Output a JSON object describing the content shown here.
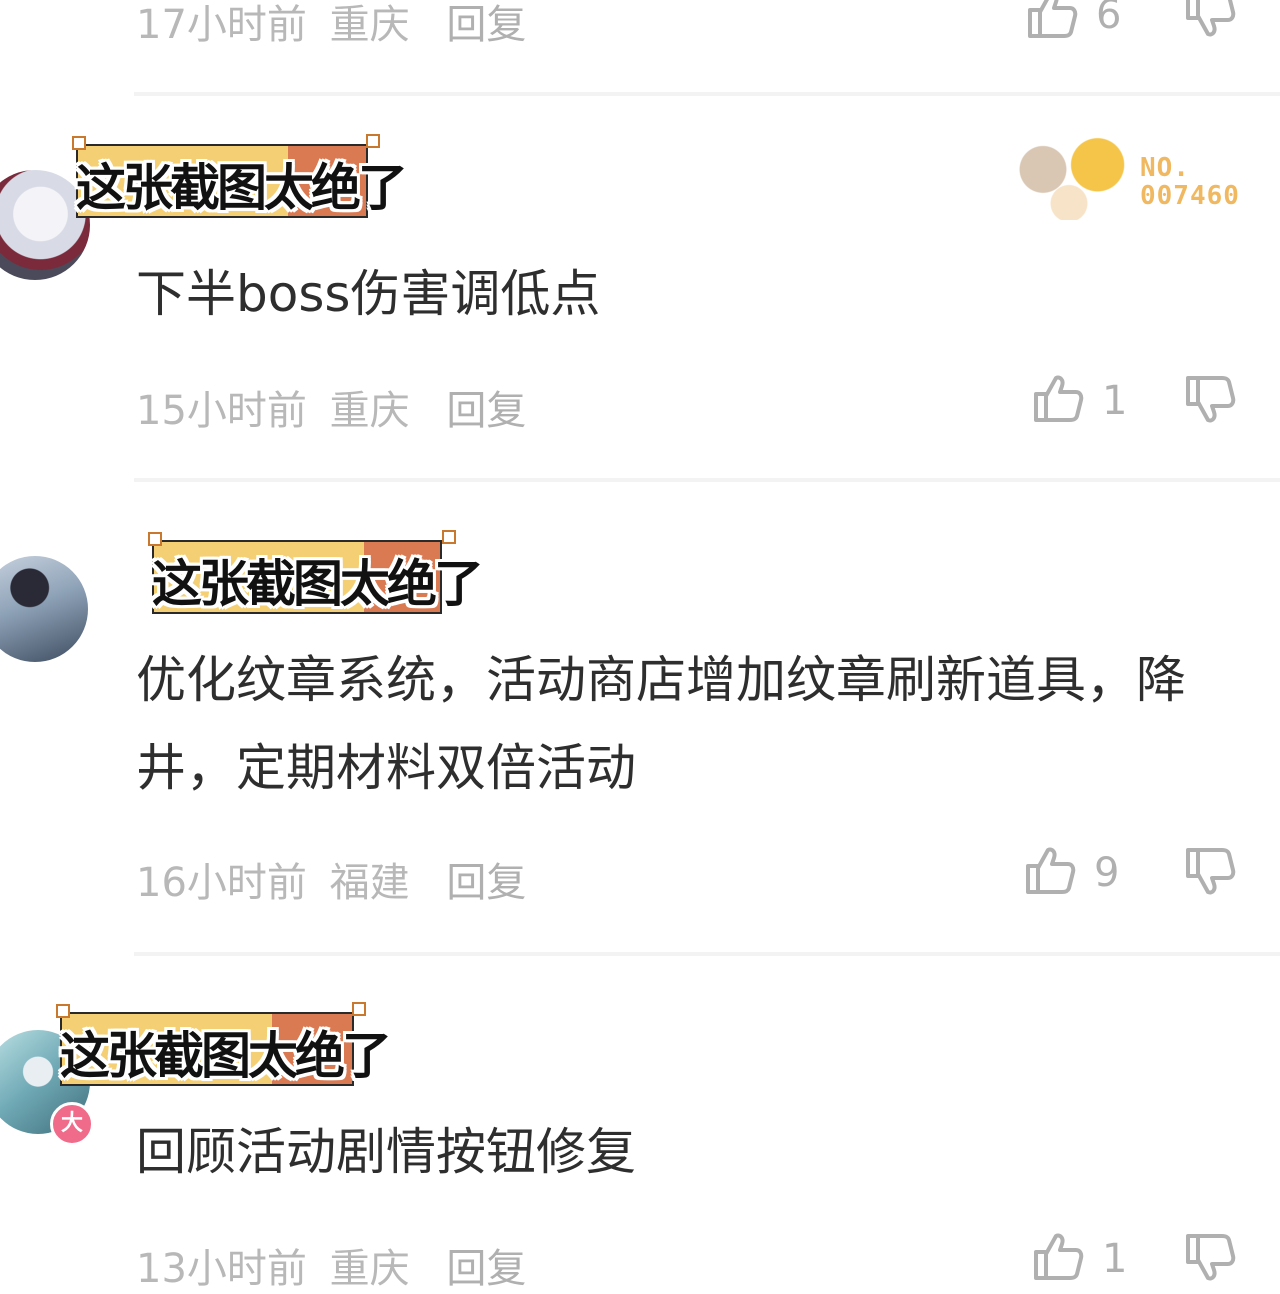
{
  "sticker_text": "这张截图太绝了",
  "comments": [
    {
      "time": "17小时前",
      "location": "重庆",
      "reply": "回复",
      "likes": "6",
      "content": ""
    },
    {
      "time": "15小时前",
      "location": "重庆",
      "reply": "回复",
      "likes": "1",
      "content": "下半boss伤害调低点",
      "badge": {
        "line1": "NO.",
        "line2": "007460"
      }
    },
    {
      "time": "16小时前",
      "location": "福建",
      "reply": "回复",
      "likes": "9",
      "content_line1": "优化纹章系统，活动商店增加纹章刷新道具，降",
      "content_line2": "井，定期材料双倍活动"
    },
    {
      "time": "13小时前",
      "location": "重庆",
      "reply": "回复",
      "likes": "1",
      "content": "回顾活动剧情按钮修复",
      "avatar_badge": "大"
    }
  ],
  "colors": {
    "background": "#ffffff",
    "meta_text": "#b8b8b8",
    "content_text": "#2e2e2e",
    "sticker_yellow": "#f4cf74",
    "sticker_orange": "#da7a52",
    "badge_gold": "#f0b860"
  },
  "icons": [
    "thumbs-up-icon",
    "thumbs-down-icon"
  ]
}
